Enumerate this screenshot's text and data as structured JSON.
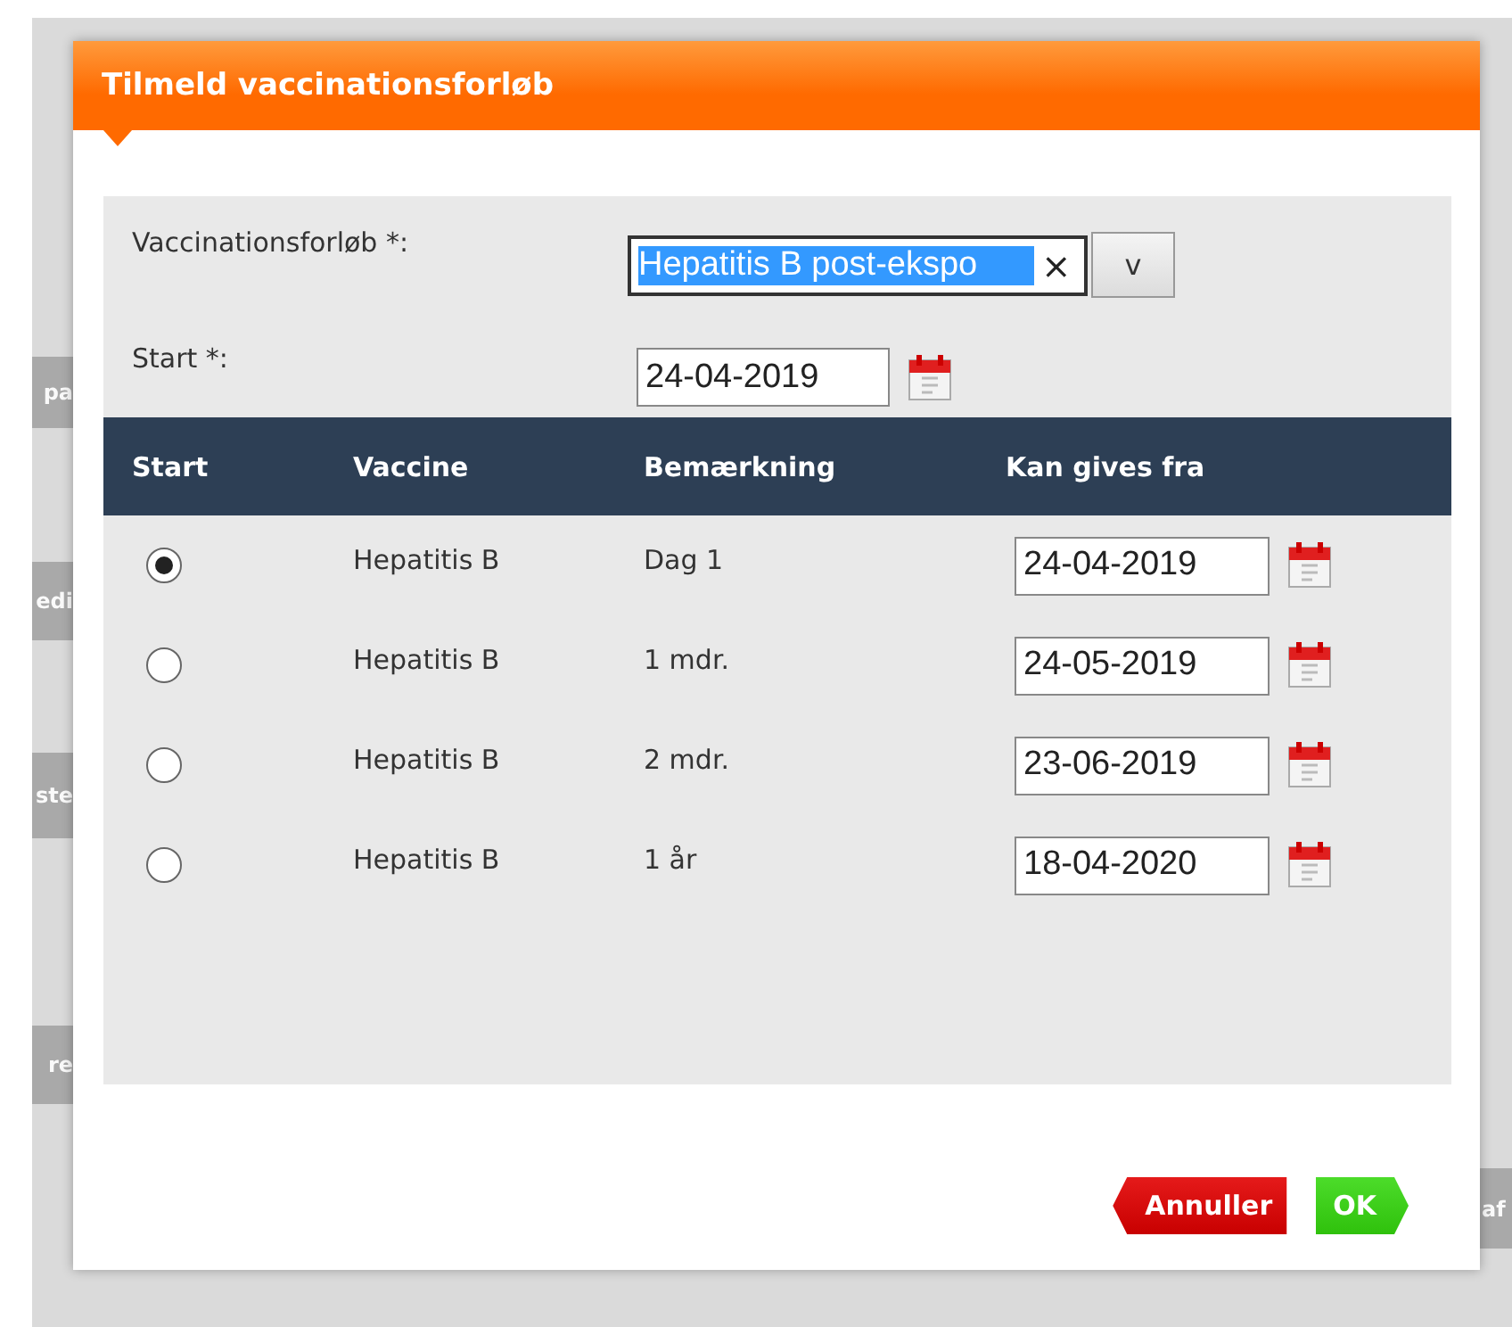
{
  "background": {
    "left_fragments": [
      "pa",
      "edi",
      "ste",
      "re"
    ],
    "right_fragments": [
      "af"
    ]
  },
  "dialog": {
    "title": "Tilmeld vaccinationsforløb",
    "fields": [
      {
        "kind": "combo",
        "label": "Vaccinationsforløb *:",
        "value": "Hepatitis B post-ekspo",
        "highlighted": true,
        "clear": "×",
        "toggle": "v"
      },
      {
        "kind": "date",
        "label": "Start *:",
        "value": "24-04-2019"
      }
    ],
    "table": {
      "columns": [
        "Start",
        "Vaccine",
        "Bemærkning",
        "Kan gives fra"
      ],
      "rows": [
        {
          "selected": true,
          "vaccine": "Hepatitis B",
          "note": "Dag 1",
          "date": "24-04-2019"
        },
        {
          "selected": false,
          "vaccine": "Hepatitis B",
          "note": "1 mdr.",
          "date": "24-05-2019"
        },
        {
          "selected": false,
          "vaccine": "Hepatitis B",
          "note": "2 mdr.",
          "date": "23-06-2019"
        },
        {
          "selected": false,
          "vaccine": "Hepatitis B",
          "note": "1 år",
          "date": "18-04-2020"
        }
      ]
    },
    "buttons": [
      {
        "kind": "cancel",
        "label": "Annuller"
      },
      {
        "kind": "ok",
        "label": "OK"
      }
    ]
  }
}
